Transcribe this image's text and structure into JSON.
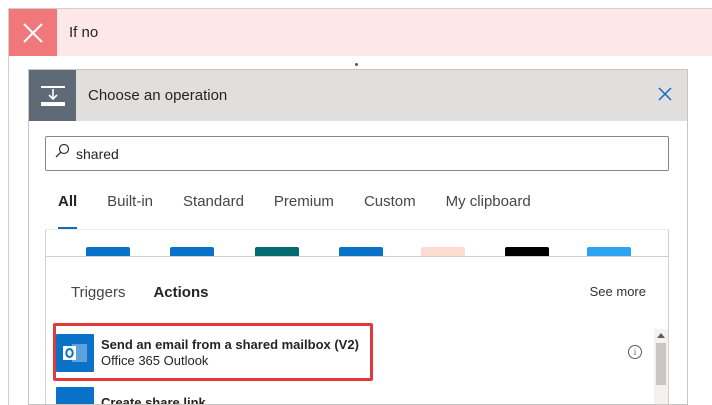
{
  "condition": {
    "label": "If no"
  },
  "panel": {
    "title": "Choose an operation",
    "search": {
      "value": "shared",
      "placeholder": "Search connectors and actions"
    },
    "tabs": [
      {
        "label": "All",
        "active": true
      },
      {
        "label": "Built-in",
        "active": false
      },
      {
        "label": "Standard",
        "active": false
      },
      {
        "label": "Premium",
        "active": false
      },
      {
        "label": "Custom",
        "active": false
      },
      {
        "label": "My clipboard",
        "active": false
      }
    ],
    "connector_colors": [
      "#0a71c8",
      "#0a71c8",
      "#036c70",
      "#0a71c8",
      "#fcdcd0",
      "#000000",
      "#2ea3f2"
    ],
    "results": {
      "sub_tabs": [
        {
          "label": "Triggers",
          "active": false
        },
        {
          "label": "Actions",
          "active": true
        }
      ],
      "see_more": "See more",
      "actions": [
        {
          "title": "Send an email from a shared mailbox (V2)",
          "subtitle": "Office 365 Outlook",
          "icon": "outlook-icon"
        },
        {
          "title": "Create share link",
          "subtitle": "",
          "icon": "onedrive-icon"
        }
      ]
    }
  },
  "colors": {
    "accent": "#0f6cbd",
    "highlight": "#e03a3a",
    "condition_no": "#f0787a",
    "condition_bg": "#fde7e9"
  }
}
